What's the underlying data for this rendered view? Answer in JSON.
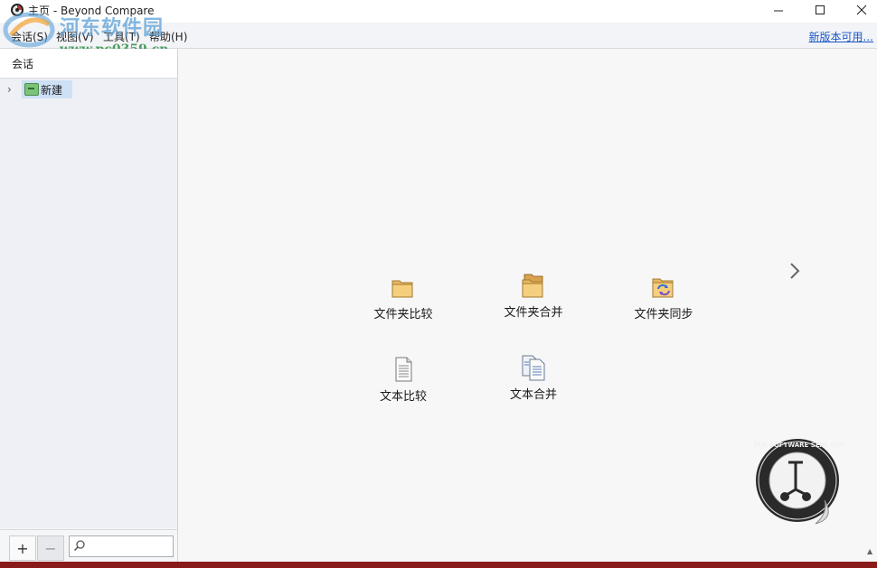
{
  "window": {
    "title": "主页 - Beyond Compare",
    "controls": [
      "minimize",
      "maximize",
      "close"
    ]
  },
  "watermark": {
    "title": "河东软件园",
    "url": "www.pc0359.cn"
  },
  "menubar": {
    "items": [
      "会话(S)",
      "视图(V)",
      "工具(T)",
      "帮助(H)"
    ],
    "update_link": "新版本可用..."
  },
  "sidebar": {
    "title": "会话",
    "tree": [
      {
        "label": "新建",
        "icon": "new-session-icon",
        "selected": true
      }
    ],
    "footer": {
      "add_label": "+",
      "remove_label": "−",
      "search_placeholder": ""
    }
  },
  "main": {
    "tiles": [
      {
        "label": "文件夹比较",
        "icon": "folder-compare-icon"
      },
      {
        "label": "文件夹合并",
        "icon": "folder-merge-icon"
      },
      {
        "label": "文件夹同步",
        "icon": "folder-sync-icon"
      },
      {
        "label": "文本比较",
        "icon": "text-compare-icon"
      },
      {
        "label": "文本合并",
        "icon": "text-merge-icon"
      }
    ],
    "next_icon": "chevron-right-icon",
    "seal_text": "SCOOTER SOFTWARE SEAL QUALITY"
  },
  "colors": {
    "accent_link": "#1a56c7",
    "selection": "#cde0f5",
    "status_bar": "#8b1a1a"
  }
}
